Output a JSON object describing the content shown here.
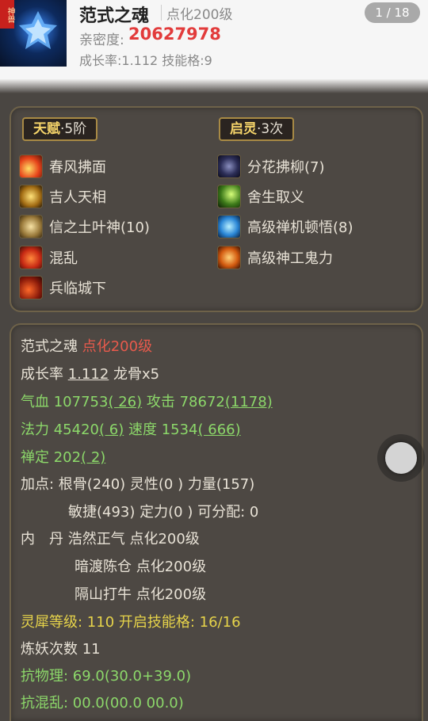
{
  "header": {
    "avatar_badge": "神兽",
    "pet_name": "范式之魂",
    "pet_level": "点化200级",
    "page_indicator": "1 / 18",
    "intimacy_label": "亲密度:",
    "intimacy_value": "20627978",
    "growth_text": "成长率:1.112 技能格:9"
  },
  "skills_panel": {
    "talent_tag": {
      "title": "天赋",
      "sub": "·5阶"
    },
    "awaken_tag": {
      "title": "启灵",
      "sub": "·3次"
    },
    "talent_skills": [
      {
        "label": "春风拂面",
        "icon": "fire-wind-icon"
      },
      {
        "label": "吉人天相",
        "icon": "golden-luck-icon"
      },
      {
        "label": "信之土叶神(10)",
        "icon": "scroll-icon"
      },
      {
        "label": "混乱",
        "icon": "chaos-flame-icon"
      },
      {
        "label": "兵临城下",
        "icon": "blade-fire-icon"
      }
    ],
    "awaken_skills": [
      {
        "label": "分花拂柳(7)",
        "icon": "dark-orb-icon"
      },
      {
        "label": "舍生取义",
        "icon": "green-slash-icon"
      },
      {
        "label": "高级禅机顿悟(8)",
        "icon": "blue-zen-icon"
      },
      {
        "label": "高级神工鬼力",
        "icon": "orange-power-icon"
      }
    ]
  },
  "stats_panel": {
    "name": "范式之魂",
    "level": "点化200级",
    "growth_label": "成长率",
    "growth_value": "1.112",
    "dragon_bone": "龙骨x5",
    "hp_label": "气血",
    "hp_value": "107753",
    "hp_bonus": "( 26)",
    "atk_label": "攻击",
    "atk_value": "78672",
    "atk_bonus": "(1178)",
    "mp_label": "法力",
    "mp_value": "45420",
    "mp_bonus": "( 6)",
    "spd_label": "速度",
    "spd_value": "1534",
    "spd_bonus": "( 666)",
    "calm_label": "禅定",
    "calm_value": "202",
    "calm_bonus": "( 2)",
    "points_line1": "加点:  根骨(240) 灵性(0 ) 力量(157)",
    "points_line2": "敏捷(493) 定力(0 ) 可分配: 0",
    "core_label": "内　丹",
    "core_1": "浩然正气 点化200级",
    "core_2": "暗渡陈仓 点化200级",
    "core_3": "隔山打牛 点化200级",
    "rhino_line": "灵犀等级: 110 开启技能格: 16/16",
    "refine_line": "炼妖次数 11",
    "phys_res_line": "抗物理: 69.0(30.0+39.0)",
    "cut_line": "抗混乱: 00.0(00.0 00.0)"
  }
}
